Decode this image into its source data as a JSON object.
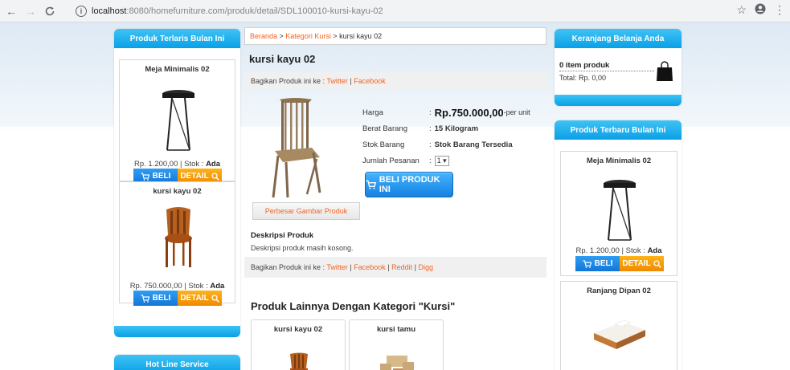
{
  "browser": {
    "back": "←",
    "forward": "→",
    "reload": "C",
    "info": "i",
    "url_host": "localhost",
    "url_path": ":8080/homefurniture.com/produk/detail/SDL100010-kursi-kayu-02",
    "star": "☆",
    "profile": "●",
    "menu": "⋮"
  },
  "left": {
    "best_title": "Produk Terlaris Bulan Ini",
    "products": [
      {
        "name": "Meja Minimalis 02",
        "price": "Rp. 1.200,00",
        "stock_label": "| Stok :",
        "stock": "Ada",
        "beli": "BELI",
        "detail": "DETAIL"
      },
      {
        "name": "kursi kayu 02",
        "price": "Rp. 750.000,00",
        "stock_label": "| Stok :",
        "stock": "Ada",
        "beli": "BELI",
        "detail": "DETAIL"
      }
    ],
    "hotline_title": "Hot Line Service"
  },
  "main": {
    "breadcrumb": {
      "home": "Beranda",
      "sep1": " > ",
      "category": "Kategori Kursi",
      "sep2": " > ",
      "current": "kursi kayu 02"
    },
    "title": "kursi kayu 02",
    "share_top": {
      "label": "Bagikan Produk ini ke : ",
      "twitter": "Twitter",
      "sep": " | ",
      "facebook": "Facebook"
    },
    "info": {
      "price_label": "Harga",
      "price_value": "Rp.750.000,00",
      "price_unit": " -per unit",
      "weight_label": "Berat Barang",
      "weight_value": "15 Kilogram",
      "stock_label": "Stok Barang",
      "stock_value": "Stok Barang Tersedia",
      "qty_label": "Jumlah Pesanan",
      "qty_value": "1 ▾",
      "colon": ":"
    },
    "buy_button": "BELI PRODUK INI",
    "zoom_button": "Perbesar Gambar Produk",
    "desc_title": "Deskripsi Produk",
    "desc_text": "Deskripsi produk masih kosong.",
    "share_bottom": {
      "label": "Bagikan Produk ini ke : ",
      "twitter": "Twitter",
      "facebook": "Facebook",
      "reddit": "Reddit",
      "digg": "Digg",
      "sep": " | "
    },
    "other_title": "Produk Lainnya Dengan Kategori \"Kursi\"",
    "other_products": [
      {
        "name": "kursi kayu 02"
      },
      {
        "name": "kursi tamu"
      }
    ]
  },
  "right": {
    "cart_title": "Keranjang Belanja Anda",
    "cart_items": "0 item produk",
    "cart_total": "Total: Rp. 0,00",
    "new_title": "Produk Terbaru Bulan Ini",
    "products": [
      {
        "name": "Meja Minimalis 02",
        "price": "Rp. 1.200,00",
        "stock_label": "| Stok :",
        "stock": "Ada",
        "beli": "BELI",
        "detail": "DETAIL"
      },
      {
        "name": "Ranjang Dipan 02"
      }
    ]
  },
  "colors": {
    "accent_blue": "#0aa0e6",
    "link_orange": "#f26522",
    "detail_orange": "#f08a00",
    "beli_blue": "#1376d8"
  }
}
